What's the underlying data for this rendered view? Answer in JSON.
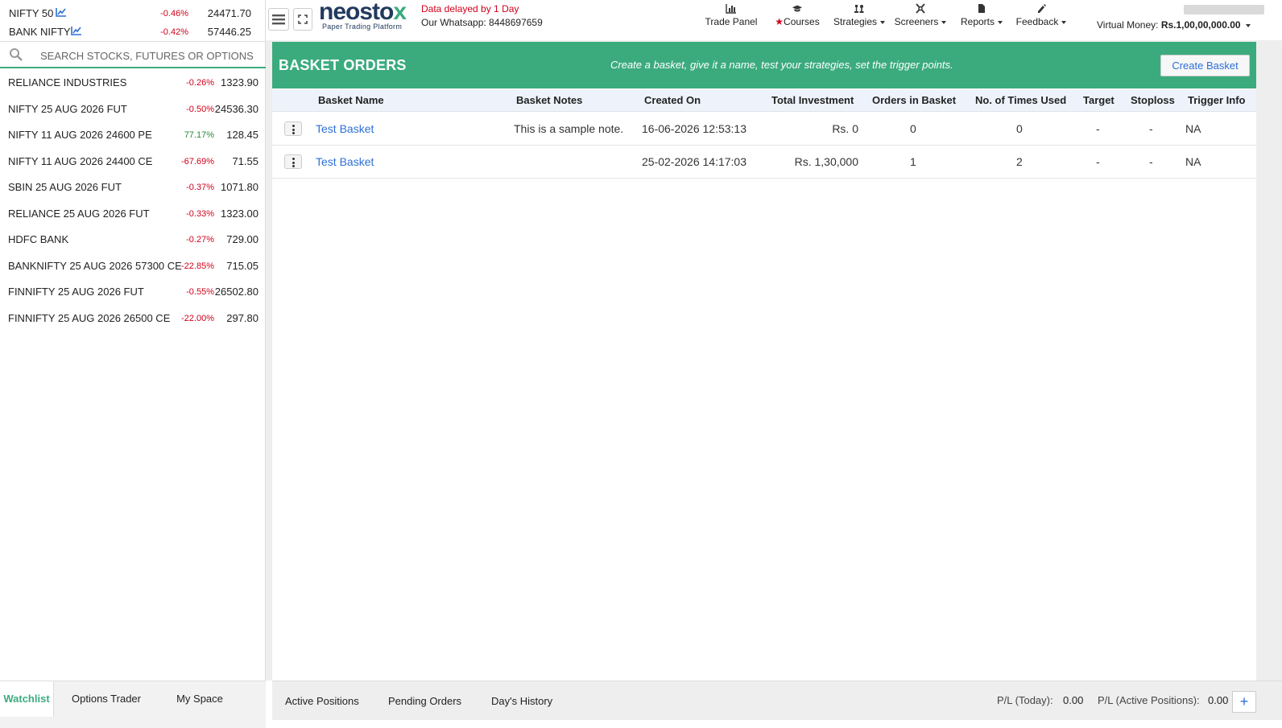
{
  "indices": [
    {
      "name": "NIFTY 50",
      "change": "-0.46%",
      "value": "24471.70",
      "icon": "line-chart-icon"
    },
    {
      "name": "BANK NIFTY",
      "change": "-0.42%",
      "value": "57446.25",
      "icon": "line-chart-icon"
    }
  ],
  "search": {
    "placeholder": "SEARCH STOCKS, FUTURES OR OPTIONS",
    "icon": "search-icon"
  },
  "watchlist": [
    {
      "name": "RELIANCE INDUSTRIES",
      "change": "-0.26%",
      "value": "1323.90",
      "dir": "neg"
    },
    {
      "name": "NIFTY 25 AUG 2026 FUT",
      "change": "-0.50%",
      "value": "24536.30",
      "dir": "neg"
    },
    {
      "name": "NIFTY 11 AUG 2026 24600 PE",
      "change": "77.17%",
      "value": "128.45",
      "dir": "pos"
    },
    {
      "name": "NIFTY 11 AUG 2026 24400 CE",
      "change": "-67.69%",
      "value": "71.55",
      "dir": "neg"
    },
    {
      "name": "SBIN 25 AUG 2026 FUT",
      "change": "-0.37%",
      "value": "1071.80",
      "dir": "neg"
    },
    {
      "name": "RELIANCE 25 AUG 2026 FUT",
      "change": "-0.33%",
      "value": "1323.00",
      "dir": "neg"
    },
    {
      "name": "HDFC BANK",
      "change": "-0.27%",
      "value": "729.00",
      "dir": "neg"
    },
    {
      "name": "BANKNIFTY 25 AUG 2026 57300 CE",
      "change": "-22.85%",
      "value": "715.05",
      "dir": "neg"
    },
    {
      "name": "FINNIFTY 25 AUG 2026 FUT",
      "change": "-0.55%",
      "value": "26502.80",
      "dir": "neg"
    },
    {
      "name": "FINNIFTY 25 AUG 2026 26500 CE",
      "change": "-22.00%",
      "value": "297.80",
      "dir": "neg"
    }
  ],
  "left_tabs": [
    "Watchlist",
    "Options Trader",
    "My Space"
  ],
  "header": {
    "brand_main": "neosto",
    "brand_x": "x",
    "brand_tagline": "Paper Trading Platform",
    "delay_notice": "Data delayed by 1 Day",
    "whatsapp": "Our Whatsapp: 8448697659",
    "nav": [
      {
        "label": "Trade Panel",
        "icon": "bar-chart-icon",
        "dropdown": false
      },
      {
        "label": "Courses",
        "icon": "graduation-cap-icon",
        "dropdown": false
      },
      {
        "label": "Strategies",
        "icon": "chess-icon",
        "dropdown": true
      },
      {
        "label": "Screeners",
        "icon": "screener-icon",
        "dropdown": true
      },
      {
        "label": "Reports",
        "icon": "document-icon",
        "dropdown": true
      },
      {
        "label": "Feedback",
        "icon": "pencil-icon",
        "dropdown": true
      }
    ],
    "virtual_money_label": "Virtual Money:",
    "virtual_money_value": "Rs.1,00,00,000.00"
  },
  "banner": {
    "title": "BASKET ORDERS",
    "subtitle": "Create a basket, give it a name, test your strategies, set the trigger points.",
    "create_button": "Create Basket",
    "color": "#3bab7e"
  },
  "table": {
    "columns": [
      "Basket Name",
      "Basket Notes",
      "Created On",
      "Total Investment",
      "Orders in Basket",
      "No. of Times Used",
      "Target",
      "Stoploss",
      "Trigger Info"
    ],
    "rows": [
      {
        "name": "Test Basket",
        "notes": "This is a sample note.",
        "created": "16-06-2026 12:53:13",
        "investment": "Rs. 0",
        "orders": "0",
        "used": "0",
        "target": "-",
        "stoploss": "-",
        "trigger": "NA"
      },
      {
        "name": "Test Basket",
        "notes": "",
        "created": "25-02-2026 14:17:03",
        "investment": "Rs. 1,30,000",
        "orders": "1",
        "used": "2",
        "target": "-",
        "stoploss": "-",
        "trigger": "NA"
      }
    ]
  },
  "bottom": {
    "tabs": [
      "Active Positions",
      "Pending Orders",
      "Day's History"
    ],
    "pl_today_label": "P/L (Today):",
    "pl_today_value": "0.00",
    "pl_active_label": "P/L (Active Positions):",
    "pl_active_value": "0.00",
    "add_label": "+"
  }
}
